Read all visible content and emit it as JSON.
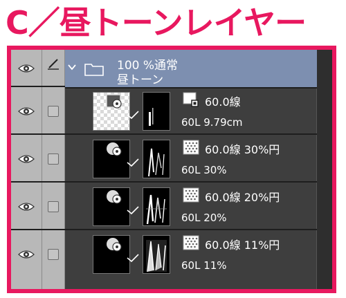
{
  "title": "C／昼トーンレイヤー",
  "colors": {
    "accent": "#e8185f",
    "folder_row": "#7d8fb0",
    "panel": "#3e3e3e"
  },
  "folder": {
    "line1": "100 %通常",
    "line2": "昼トーン"
  },
  "layers": [
    {
      "line1": "60.0線",
      "line2": "60L 9.79cm"
    },
    {
      "line1": "60.0線 30%円",
      "line2": "60L 30%"
    },
    {
      "line1": "60.0線 20%円",
      "line2": "60L 20%"
    },
    {
      "line1": "60.0線 11%円",
      "line2": "60L 11%"
    }
  ]
}
